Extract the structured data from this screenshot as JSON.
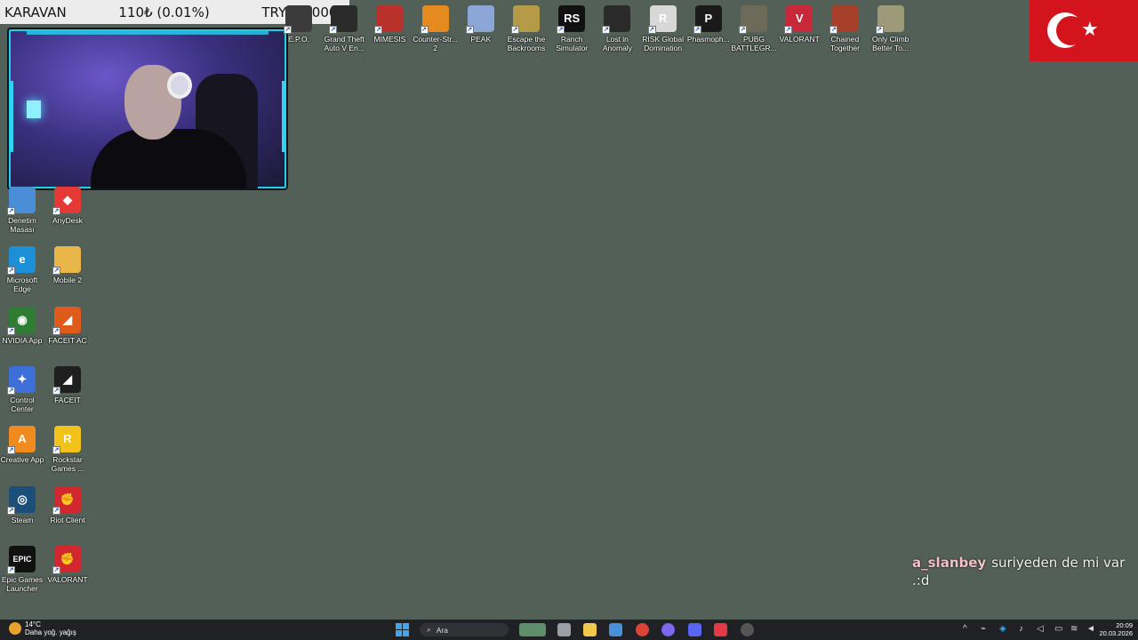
{
  "donation": {
    "name": "KARAVAN",
    "amount": "110₺ (0.01%)",
    "goal": "TRY1000000"
  },
  "top_icons": [
    {
      "label": "E.P.O.",
      "color": "#3b3b3b",
      "glyph": ""
    },
    {
      "label": "Grand Theft Auto V En...",
      "color": "#2b2b2b",
      "glyph": ""
    },
    {
      "label": "MIMESIS",
      "color": "#b8322b",
      "glyph": ""
    },
    {
      "label": "Counter-Str... 2",
      "color": "#e58a1f",
      "glyph": ""
    },
    {
      "label": "PEAK",
      "color": "#8aa7d8",
      "glyph": ""
    },
    {
      "label": "Escape the Backrooms",
      "color": "#b59a48",
      "glyph": ""
    },
    {
      "label": "Ranch Simulator",
      "color": "#111111",
      "glyph": "RS"
    },
    {
      "label": "Lost in Anomaly",
      "color": "#2a2a2a",
      "glyph": ""
    },
    {
      "label": "RISK Global Domination",
      "color": "#d8d8d8",
      "glyph": "R"
    },
    {
      "label": "Phasmoph...",
      "color": "#1a1a1a",
      "glyph": "P"
    },
    {
      "label": "PUBG BATTLEGR...",
      "color": "#6d6a5a",
      "glyph": ""
    },
    {
      "label": "VALORANT",
      "color": "#c8283a",
      "glyph": "V"
    },
    {
      "label": "Chained Together",
      "color": "#a6402a",
      "glyph": ""
    },
    {
      "label": "Only Climb Better To...",
      "color": "#9d9a7a",
      "glyph": ""
    }
  ],
  "left_icons": [
    {
      "label": "Denetim Masası",
      "color": "#4a8ed8",
      "glyph": ""
    },
    {
      "label": "AnyDesk",
      "color": "#e53935",
      "glyph": "◆"
    },
    {
      "label": "Microsoft Edge",
      "color": "#1d8fd6",
      "glyph": "e"
    },
    {
      "label": "Mobile 2",
      "color": "#e9b64a",
      "glyph": ""
    },
    {
      "label": "NVIDIA App",
      "color": "#2e7d32",
      "glyph": "◉"
    },
    {
      "label": "FACEIT AC",
      "color": "#e05a1b",
      "glyph": "◢"
    },
    {
      "label": "Control Center",
      "color": "#3d6fd8",
      "glyph": "✦"
    },
    {
      "label": "FACEIT",
      "color": "#1f1f1f",
      "glyph": "◢"
    },
    {
      "label": "Creative App",
      "color": "#f08c1f",
      "glyph": "A"
    },
    {
      "label": "Rockstar Games ...",
      "color": "#f2c21a",
      "glyph": "R"
    },
    {
      "label": "Steam",
      "color": "#1b4f7a",
      "glyph": "◎"
    },
    {
      "label": "Riot Client",
      "color": "#d3272f",
      "glyph": "✊"
    },
    {
      "label": "Epic Games Launcher",
      "color": "#111111",
      "glyph": "EPIC"
    },
    {
      "label": "VALORANT",
      "color": "#d3272f",
      "glyph": "✊"
    }
  ],
  "chat": {
    "user": "a_slanbey",
    "message": "suriyeden de mi var .:d"
  },
  "taskbar": {
    "weather_temp": "14°C",
    "weather_desc": "Daha yoğ. yağış",
    "search_placeholder": "Ara",
    "time": "20:09",
    "date": "20.03.2026"
  }
}
